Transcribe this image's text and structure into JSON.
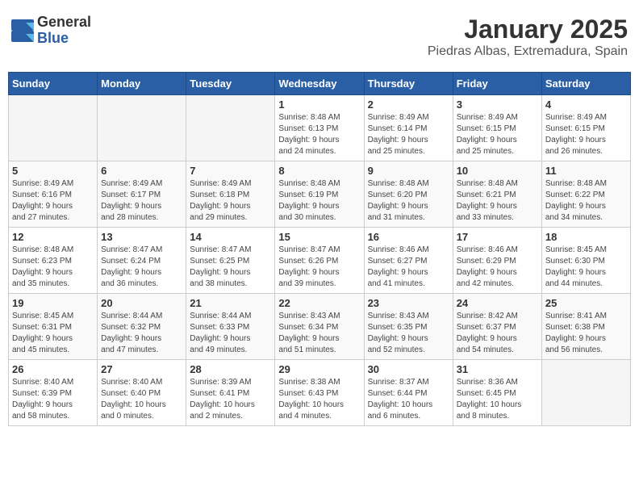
{
  "logo": {
    "general": "General",
    "blue": "Blue"
  },
  "header": {
    "month": "January 2025",
    "location": "Piedras Albas, Extremadura, Spain"
  },
  "weekdays": [
    "Sunday",
    "Monday",
    "Tuesday",
    "Wednesday",
    "Thursday",
    "Friday",
    "Saturday"
  ],
  "weeks": [
    [
      {
        "day": "",
        "info": ""
      },
      {
        "day": "",
        "info": ""
      },
      {
        "day": "",
        "info": ""
      },
      {
        "day": "1",
        "info": "Sunrise: 8:48 AM\nSunset: 6:13 PM\nDaylight: 9 hours\nand 24 minutes."
      },
      {
        "day": "2",
        "info": "Sunrise: 8:49 AM\nSunset: 6:14 PM\nDaylight: 9 hours\nand 25 minutes."
      },
      {
        "day": "3",
        "info": "Sunrise: 8:49 AM\nSunset: 6:15 PM\nDaylight: 9 hours\nand 25 minutes."
      },
      {
        "day": "4",
        "info": "Sunrise: 8:49 AM\nSunset: 6:15 PM\nDaylight: 9 hours\nand 26 minutes."
      }
    ],
    [
      {
        "day": "5",
        "info": "Sunrise: 8:49 AM\nSunset: 6:16 PM\nDaylight: 9 hours\nand 27 minutes."
      },
      {
        "day": "6",
        "info": "Sunrise: 8:49 AM\nSunset: 6:17 PM\nDaylight: 9 hours\nand 28 minutes."
      },
      {
        "day": "7",
        "info": "Sunrise: 8:49 AM\nSunset: 6:18 PM\nDaylight: 9 hours\nand 29 minutes."
      },
      {
        "day": "8",
        "info": "Sunrise: 8:48 AM\nSunset: 6:19 PM\nDaylight: 9 hours\nand 30 minutes."
      },
      {
        "day": "9",
        "info": "Sunrise: 8:48 AM\nSunset: 6:20 PM\nDaylight: 9 hours\nand 31 minutes."
      },
      {
        "day": "10",
        "info": "Sunrise: 8:48 AM\nSunset: 6:21 PM\nDaylight: 9 hours\nand 33 minutes."
      },
      {
        "day": "11",
        "info": "Sunrise: 8:48 AM\nSunset: 6:22 PM\nDaylight: 9 hours\nand 34 minutes."
      }
    ],
    [
      {
        "day": "12",
        "info": "Sunrise: 8:48 AM\nSunset: 6:23 PM\nDaylight: 9 hours\nand 35 minutes."
      },
      {
        "day": "13",
        "info": "Sunrise: 8:47 AM\nSunset: 6:24 PM\nDaylight: 9 hours\nand 36 minutes."
      },
      {
        "day": "14",
        "info": "Sunrise: 8:47 AM\nSunset: 6:25 PM\nDaylight: 9 hours\nand 38 minutes."
      },
      {
        "day": "15",
        "info": "Sunrise: 8:47 AM\nSunset: 6:26 PM\nDaylight: 9 hours\nand 39 minutes."
      },
      {
        "day": "16",
        "info": "Sunrise: 8:46 AM\nSunset: 6:27 PM\nDaylight: 9 hours\nand 41 minutes."
      },
      {
        "day": "17",
        "info": "Sunrise: 8:46 AM\nSunset: 6:29 PM\nDaylight: 9 hours\nand 42 minutes."
      },
      {
        "day": "18",
        "info": "Sunrise: 8:45 AM\nSunset: 6:30 PM\nDaylight: 9 hours\nand 44 minutes."
      }
    ],
    [
      {
        "day": "19",
        "info": "Sunrise: 8:45 AM\nSunset: 6:31 PM\nDaylight: 9 hours\nand 45 minutes."
      },
      {
        "day": "20",
        "info": "Sunrise: 8:44 AM\nSunset: 6:32 PM\nDaylight: 9 hours\nand 47 minutes."
      },
      {
        "day": "21",
        "info": "Sunrise: 8:44 AM\nSunset: 6:33 PM\nDaylight: 9 hours\nand 49 minutes."
      },
      {
        "day": "22",
        "info": "Sunrise: 8:43 AM\nSunset: 6:34 PM\nDaylight: 9 hours\nand 51 minutes."
      },
      {
        "day": "23",
        "info": "Sunrise: 8:43 AM\nSunset: 6:35 PM\nDaylight: 9 hours\nand 52 minutes."
      },
      {
        "day": "24",
        "info": "Sunrise: 8:42 AM\nSunset: 6:37 PM\nDaylight: 9 hours\nand 54 minutes."
      },
      {
        "day": "25",
        "info": "Sunrise: 8:41 AM\nSunset: 6:38 PM\nDaylight: 9 hours\nand 56 minutes."
      }
    ],
    [
      {
        "day": "26",
        "info": "Sunrise: 8:40 AM\nSunset: 6:39 PM\nDaylight: 9 hours\nand 58 minutes."
      },
      {
        "day": "27",
        "info": "Sunrise: 8:40 AM\nSunset: 6:40 PM\nDaylight: 10 hours\nand 0 minutes."
      },
      {
        "day": "28",
        "info": "Sunrise: 8:39 AM\nSunset: 6:41 PM\nDaylight: 10 hours\nand 2 minutes."
      },
      {
        "day": "29",
        "info": "Sunrise: 8:38 AM\nSunset: 6:43 PM\nDaylight: 10 hours\nand 4 minutes."
      },
      {
        "day": "30",
        "info": "Sunrise: 8:37 AM\nSunset: 6:44 PM\nDaylight: 10 hours\nand 6 minutes."
      },
      {
        "day": "31",
        "info": "Sunrise: 8:36 AM\nSunset: 6:45 PM\nDaylight: 10 hours\nand 8 minutes."
      },
      {
        "day": "",
        "info": ""
      }
    ]
  ]
}
